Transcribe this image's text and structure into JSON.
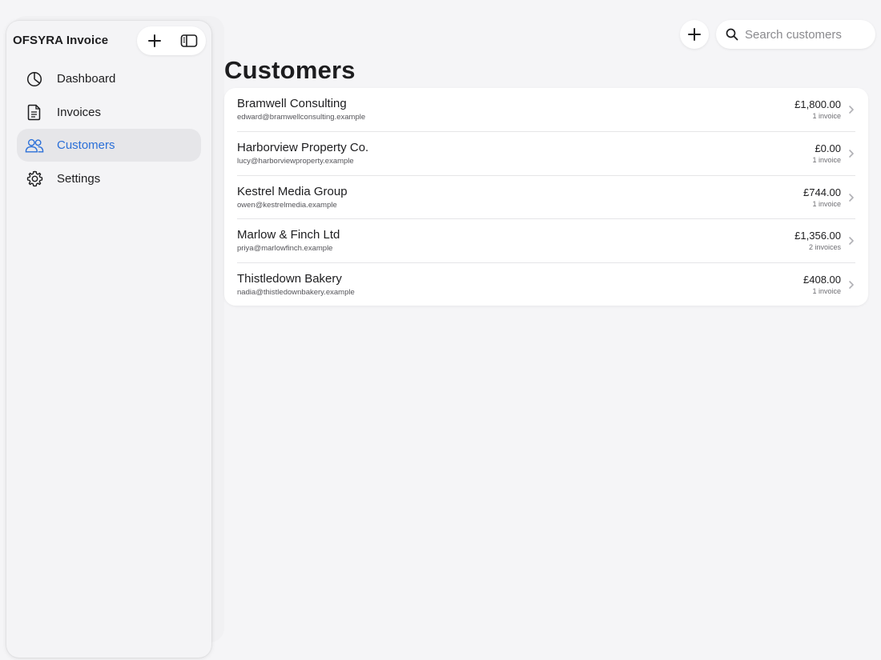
{
  "app": {
    "title": "OFSYRA Invoice"
  },
  "sidebar": {
    "items": [
      {
        "label": "Dashboard",
        "icon": "chart-pie-icon",
        "active": false
      },
      {
        "label": "Invoices",
        "icon": "document-icon",
        "active": false
      },
      {
        "label": "Customers",
        "icon": "users-icon",
        "active": true
      },
      {
        "label": "Settings",
        "icon": "gear-icon",
        "active": false
      }
    ]
  },
  "search": {
    "placeholder": "Search customers",
    "value": ""
  },
  "page": {
    "title": "Customers"
  },
  "colors": {
    "accent": "#2a6fd8",
    "background": "#f5f5f7",
    "card": "#ffffff"
  },
  "customers": [
    {
      "name": "Bramwell Consulting",
      "email": "edward@bramwellconsulting.example",
      "amount": "£1,800.00",
      "invoice_count": "1 invoice"
    },
    {
      "name": "Harborview Property Co.",
      "email": "lucy@harborviewproperty.example",
      "amount": "£0.00",
      "invoice_count": "1 invoice"
    },
    {
      "name": "Kestrel Media Group",
      "email": "owen@kestrelmedia.example",
      "amount": "£744.00",
      "invoice_count": "1 invoice"
    },
    {
      "name": "Marlow & Finch Ltd",
      "email": "priya@marlowfinch.example",
      "amount": "£1,356.00",
      "invoice_count": "2 invoices"
    },
    {
      "name": "Thistledown Bakery",
      "email": "nadia@thistledownbakery.example",
      "amount": "£408.00",
      "invoice_count": "1 invoice"
    }
  ]
}
